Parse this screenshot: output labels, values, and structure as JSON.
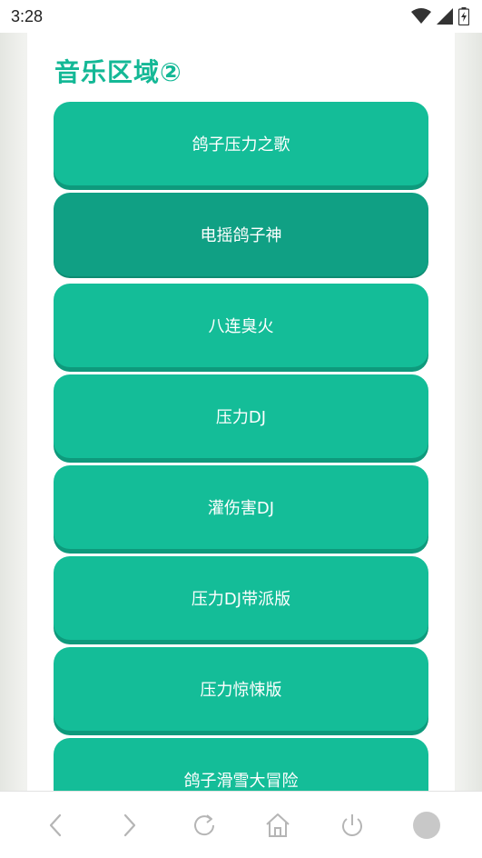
{
  "status_bar": {
    "time": "3:28"
  },
  "section": {
    "title": "音乐区域②"
  },
  "buttons": [
    {
      "label": "鸽子压力之歌"
    },
    {
      "label": "电摇鸽子神"
    },
    {
      "label": "八连臭火"
    },
    {
      "label": "压力DJ"
    },
    {
      "label": "灌伤害DJ"
    },
    {
      "label": "压力DJ带派版"
    },
    {
      "label": "压力惊悚版"
    },
    {
      "label": "鸽子滑雪大冒险"
    }
  ],
  "nav": {
    "back_icon": "chevron-left-icon",
    "forward_icon": "chevron-right-icon",
    "reload_icon": "reload-icon",
    "home_icon": "home-icon",
    "power_icon": "power-icon",
    "record_icon": "circle-icon"
  },
  "colors": {
    "accent": "#14bd98",
    "title": "#14b896",
    "pressed": "#10a084"
  }
}
